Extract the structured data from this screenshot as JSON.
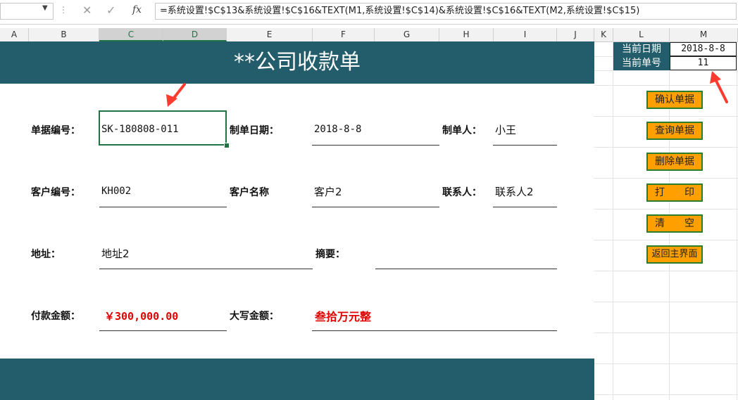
{
  "formula_bar": {
    "name_box": "",
    "formula": "=系统设置!$C$13&系统设置!$C$16&TEXT(M1,系统设置!$C$14)&系统设置!$C$16&TEXT(M2,系统设置!$C$15)"
  },
  "columns": [
    "A",
    "B",
    "C",
    "D",
    "E",
    "F",
    "G",
    "H",
    "I",
    "J",
    "K",
    "L",
    "M"
  ],
  "form": {
    "title": "**公司收款单",
    "doc_no_label": "单据编号：",
    "doc_no_value": "SK-180808-011",
    "date_label": "制单日期：",
    "date_value": "2018-8-8",
    "maker_label": "制单人：",
    "maker_value": "小王",
    "cust_no_label": "客户编号：",
    "cust_no_value": "KH002",
    "cust_name_label": "客户名称",
    "cust_name_value": "客户2",
    "contact_label": "联系人：",
    "contact_value": "联系人2",
    "address_label": "地址：",
    "address_value": "地址2",
    "summary_label": "摘要：",
    "summary_value": "",
    "amount_label": "付款金额：",
    "amount_value": "￥300,000.00",
    "amount_cn_label": "大写金额：",
    "amount_cn_value": "叁拾万元整"
  },
  "info": {
    "date_label": "当前日期",
    "date_value": "2018-8-8",
    "no_label": "当前单号",
    "no_value": "11"
  },
  "buttons": {
    "confirm": "确认单据",
    "query": "查询单据",
    "delete": "删除单据",
    "print_a": "打",
    "print_b": "印",
    "clear_a": "清",
    "clear_b": "空",
    "home": "返回主界面"
  },
  "colors": {
    "banner": "#235c6b",
    "button": "#ffa000",
    "button_border": "#2a7d2a",
    "accent_red": "#e00000",
    "selection": "#217346"
  }
}
